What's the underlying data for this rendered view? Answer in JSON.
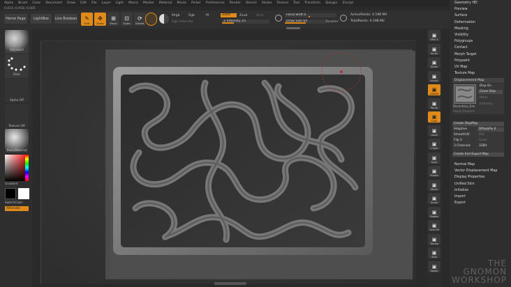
{
  "menu": [
    "Alpha",
    "Brush",
    "Color",
    "Document",
    "Draw",
    "Edit",
    "File",
    "Layer",
    "Light",
    "Macro",
    "Marker",
    "Material",
    "Movie",
    "Picker",
    "Preferences",
    "Render",
    "Stencil",
    "Stroke",
    "Texture",
    "Tool",
    "Transform",
    "Zplugin",
    "Zscript"
  ],
  "coords": "0.833,-0.958,-0.005",
  "shelf": {
    "home": "Home Page",
    "lightbox": "LightBox",
    "live_boolean": "Live Boolean",
    "tools": [
      {
        "label": "Edit",
        "icon": "edit-icon"
      },
      {
        "label": "Draw",
        "icon": "draw-icon"
      },
      {
        "label": "Move",
        "icon": "move-icon"
      },
      {
        "label": "Scale",
        "icon": "scale-icon"
      },
      {
        "label": "Rotate",
        "icon": "rotate-icon"
      }
    ],
    "mrgb": "Mrgb",
    "rgb": "Rgb",
    "m": "M",
    "rgb_intensity": "Rgb Intensity",
    "zadd": "Zadd",
    "zsub": "Zsub",
    "zcut": "Zcut",
    "z_intensity": "Z Intensity 25",
    "z_intensity_value": 25,
    "focal_shift": "Focal Shift 0",
    "draw_size": "Draw Size 64",
    "dynamic": "Dynamic",
    "active_points": "ActivePoints: 4.198 Mil",
    "total_points": "TotalPoints: 4.198 Mil"
  },
  "left": {
    "brush": "Standard",
    "stroke": "Dots",
    "alpha": "Alpha Off",
    "texture": "Texture Off",
    "material": "BasicMaterial",
    "gradient": "Gradient",
    "switch_color": "SwitchColor",
    "alternate": "Alternate"
  },
  "rshelf": [
    {
      "label": "SPix 3",
      "icon": "spix-icon"
    },
    {
      "label": "Scroll",
      "icon": "scroll-icon"
    },
    {
      "label": "Zoom",
      "icon": "zoom-icon"
    },
    {
      "label": "Actual",
      "icon": "actual-icon"
    },
    {
      "label": "AAHalf",
      "icon": "aahalf-icon"
    },
    {
      "label": "Persp",
      "icon": "persp-icon"
    },
    {
      "label": "Floor",
      "icon": "floor-icon"
    },
    {
      "label": "Local",
      "icon": "local-icon"
    },
    {
      "label": "L.Sym",
      "icon": "lsym-icon"
    },
    {
      "label": "Qxyz",
      "icon": "qxyz-icon"
    },
    {
      "label": "Frame",
      "icon": "frame-icon"
    },
    {
      "label": "Move",
      "icon": "move-icon"
    },
    {
      "label": "Scale",
      "icon": "scale-icon"
    },
    {
      "label": "Rotate",
      "icon": "rotate-icon"
    },
    {
      "label": "Line Fill",
      "icon": "linefill-icon"
    },
    {
      "label": "Transp",
      "icon": "transp-icon"
    },
    {
      "label": "Solo",
      "icon": "solo-icon"
    },
    {
      "label": "Xpose",
      "icon": "xpose-icon"
    }
  ],
  "panel": {
    "items_top": [
      "Geometry HD",
      "Preview",
      "Surface",
      "Deformation",
      "Masking",
      "Visibility",
      "Polygroups",
      "Contact",
      "Morph Target",
      "Polypaint",
      "UV Map",
      "Texture Map"
    ],
    "displacement": "Displacement Map",
    "map_thumb": "Decorative_Emi",
    "map_sub": "Ready Displace",
    "disp_on": "Disp On",
    "clone_disp": "Clone Disp",
    "mode": "Mode",
    "intensity": "Intensity",
    "create_dispmap": "Create DispMap",
    "adaptive": "Adaptive",
    "dpsubpix": "DPSubPix 0",
    "smoothuv": "SmoothUV",
    "mid": "Mid",
    "flipv": "Flip V",
    "scale": "Scale",
    "channels": "3 Channels",
    "bits": "32Bit",
    "create_export": "Create And Export Map",
    "items_bottom": [
      "Normal Map",
      "Vector Displacement Map",
      "Display Properties",
      "Unified Skin",
      "Initialize",
      "Import",
      "Export"
    ]
  },
  "brand": {
    "line1": "THE GNOMON",
    "line2": "WORKSHOP"
  },
  "colors": {
    "accent": "#e08a1a"
  }
}
